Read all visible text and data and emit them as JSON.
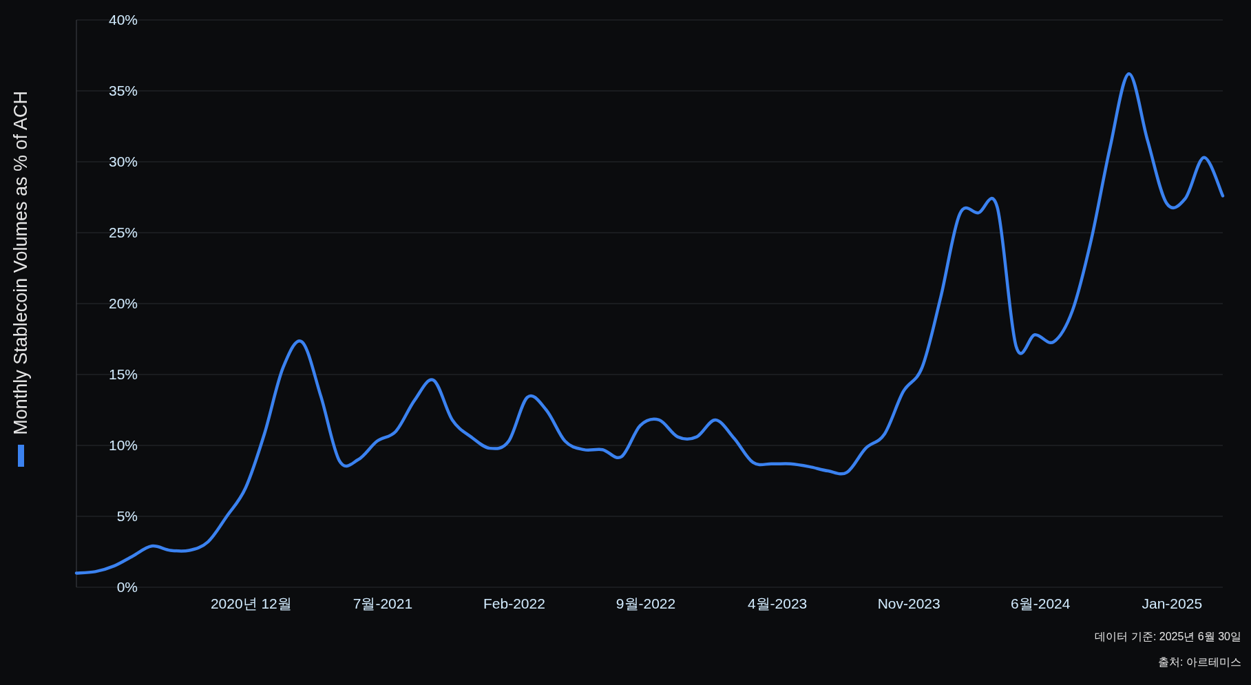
{
  "chart": {
    "chart_data": {
      "type": "line",
      "categories": [
        null,
        null,
        null,
        null,
        null,
        null,
        null,
        null,
        null,
        "2020년 12월",
        null,
        null,
        null,
        null,
        null,
        null,
        "7월-2021",
        null,
        null,
        null,
        null,
        null,
        null,
        "Feb-2022",
        null,
        null,
        null,
        null,
        null,
        null,
        "9월-2022",
        null,
        null,
        null,
        null,
        null,
        null,
        "4월-2023",
        null,
        null,
        null,
        null,
        null,
        null,
        "Nov-2023",
        null,
        null,
        null,
        null,
        null,
        null,
        "6월-2024",
        null,
        null,
        null,
        null,
        null,
        null,
        "Jan-2025",
        null,
        null,
        null
      ],
      "series": [
        {
          "name": "Monthly Stablecoin Volumes as % of ACH",
          "color": "#3b82f0",
          "values": [
            1.0,
            1.1,
            1.5,
            2.2,
            2.9,
            2.6,
            2.6,
            3.2,
            5.0,
            7.0,
            10.8,
            15.5,
            17.3,
            13.5,
            8.9,
            9.0,
            10.3,
            11.0,
            13.2,
            14.6,
            11.8,
            10.6,
            9.8,
            10.3,
            13.4,
            12.5,
            10.3,
            9.7,
            9.7,
            9.2,
            11.4,
            11.8,
            10.6,
            10.6,
            11.8,
            10.5,
            8.8,
            8.7,
            8.7,
            8.5,
            8.2,
            8.1,
            9.8,
            10.8,
            13.8,
            15.5,
            20.5,
            26.3,
            26.4,
            26.8,
            17.0,
            17.8,
            17.3,
            19.5,
            24.5,
            31.0,
            36.2,
            31.5,
            27.1,
            27.4,
            30.3,
            27.6
          ]
        }
      ],
      "ylim": [
        0,
        40
      ],
      "grid": true,
      "yticks": [
        {
          "value": 0,
          "label": "0%"
        },
        {
          "value": 5,
          "label": "5%"
        },
        {
          "value": 10,
          "label": "10%"
        },
        {
          "value": 15,
          "label": "15%"
        },
        {
          "value": 20,
          "label": "20%"
        },
        {
          "value": 25,
          "label": "25%"
        },
        {
          "value": 30,
          "label": "30%"
        },
        {
          "value": 35,
          "label": "35%"
        },
        {
          "value": 40,
          "label": "40%"
        }
      ]
    }
  },
  "footer": {
    "data_date": "데이터 기준: 2025년 6월 30일",
    "source": "출처: 아르테미스"
  }
}
